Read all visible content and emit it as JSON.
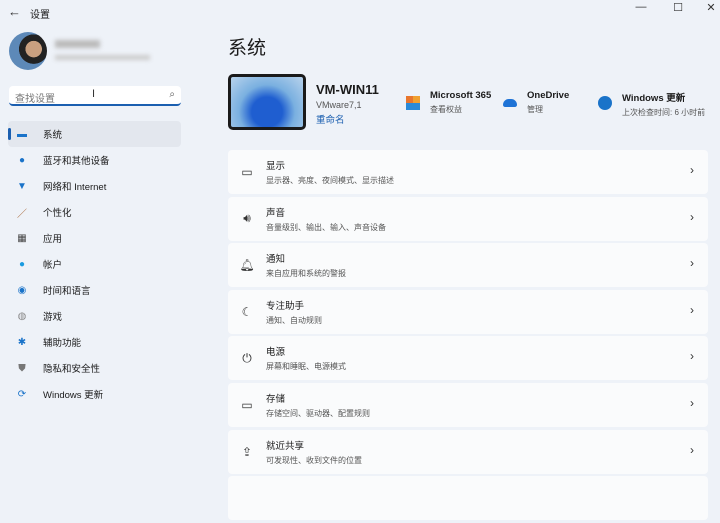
{
  "window": {
    "title": "设置",
    "back": "←",
    "min": "—",
    "max": "☐",
    "close": "✕"
  },
  "search": {
    "placeholder": "查找设置",
    "icon": "⌕"
  },
  "nav": [
    {
      "label": "系统",
      "icon": "▬",
      "color": "#1a73c9"
    },
    {
      "label": "蓝牙和其他设备",
      "icon": "●",
      "color": "#1a73c9"
    },
    {
      "label": "网络和 Internet",
      "icon": "▼",
      "color": "#1a73c9"
    },
    {
      "label": "个性化",
      "icon": "／",
      "color": "#a86a3a"
    },
    {
      "label": "应用",
      "icon": "▦",
      "color": "#444"
    },
    {
      "label": "帐户",
      "icon": "●",
      "color": "#1a9be0"
    },
    {
      "label": "时间和语言",
      "icon": "◉",
      "color": "#1a73c9"
    },
    {
      "label": "游戏",
      "icon": "◍",
      "color": "#888"
    },
    {
      "label": "辅助功能",
      "icon": "✱",
      "color": "#1a73c9"
    },
    {
      "label": "隐私和安全性",
      "icon": "⛊",
      "color": "#777"
    },
    {
      "label": "Windows 更新",
      "icon": "⟳",
      "color": "#1a73c9"
    }
  ],
  "main": {
    "title": "系统",
    "device": {
      "name": "VM-WIN11",
      "model": "VMware7,1",
      "rename": "重命名"
    },
    "quick": [
      {
        "title": "Microsoft 365",
        "sub": "查看权益"
      },
      {
        "title": "OneDrive",
        "sub": "管理"
      },
      {
        "title": "Windows 更新",
        "sub": "上次检查时间: 6 小时前"
      }
    ],
    "cards": [
      {
        "title": "显示",
        "sub": "显示器、亮度、夜间模式、显示描述",
        "icon": "▭"
      },
      {
        "title": "声音",
        "sub": "音量级别、输出、输入、声音设备",
        "icon": "🔊︎"
      },
      {
        "title": "通知",
        "sub": "来自应用和系统的警报",
        "icon": "🔔︎"
      },
      {
        "title": "专注助手",
        "sub": "通知、自动规则",
        "icon": "☾"
      },
      {
        "title": "电源",
        "sub": "屏幕和睡眠、电源模式",
        "icon": "⏻"
      },
      {
        "title": "存储",
        "sub": "存储空间、驱动器、配置规则",
        "icon": "▭"
      },
      {
        "title": "就近共享",
        "sub": "可发现性、收到文件的位置",
        "icon": "⇪"
      },
      {
        "title": "",
        "sub": "",
        "icon": ""
      }
    ],
    "chevron": "›"
  }
}
